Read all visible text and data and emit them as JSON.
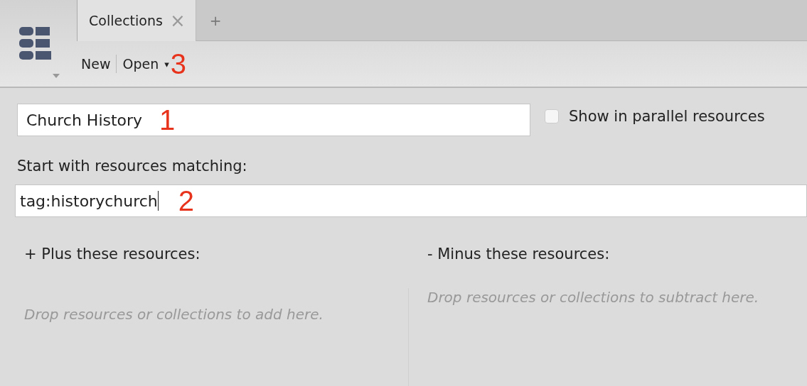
{
  "tabs": [
    {
      "label": "Collections",
      "close": "×",
      "selected": true
    }
  ],
  "new_tab": "+",
  "toolbar": {
    "new": "New",
    "open": "Open",
    "open_caret": "▾"
  },
  "annotations": [
    {
      "kind": "field",
      "text": "1"
    },
    {
      "kind": "query",
      "text": "2"
    },
    {
      "kind": "toolbar",
      "text": "3"
    }
  ],
  "collection": {
    "name": "Church History",
    "show_in_parallel": {
      "label": "Show in parallel resources",
      "checked": false
    }
  },
  "query": {
    "label": "Start with resources matching:",
    "value": "tag:historychurch"
  },
  "plus": {
    "heading": "+ Plus these resources:",
    "placeholder": "Drop resources or collections to add here."
  },
  "minus": {
    "heading": "- Minus these resources:",
    "placeholder": "Drop resources or collections to subtract here."
  }
}
